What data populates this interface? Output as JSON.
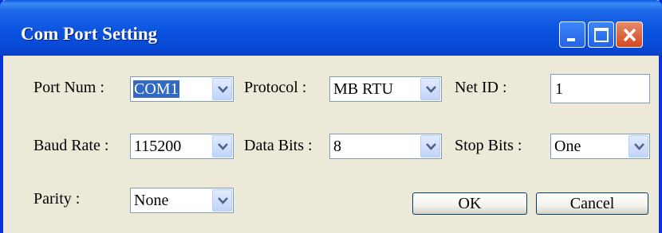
{
  "window": {
    "title": "Com Port Setting"
  },
  "titlebar_buttons": {
    "minimize": "minimize-icon",
    "maximize": "maximize-icon",
    "close": "close-icon"
  },
  "fields": {
    "port_num": {
      "label": "Port Num :",
      "value": "COM1"
    },
    "protocol": {
      "label": "Protocol :",
      "value": "MB RTU"
    },
    "net_id": {
      "label": "Net ID :",
      "value": "1"
    },
    "baud_rate": {
      "label": "Baud Rate :",
      "value": "115200"
    },
    "data_bits": {
      "label": "Data Bits :",
      "value": "8"
    },
    "stop_bits": {
      "label": "Stop Bits :",
      "value": "One"
    },
    "parity": {
      "label": "Parity :",
      "value": "None"
    }
  },
  "buttons": {
    "ok": "OK",
    "cancel": "Cancel"
  },
  "colors": {
    "title_bar": "#0a54e0",
    "dialog_bg": "#ece9d8",
    "selection": "#316ac5",
    "close_button": "#d4481e"
  }
}
